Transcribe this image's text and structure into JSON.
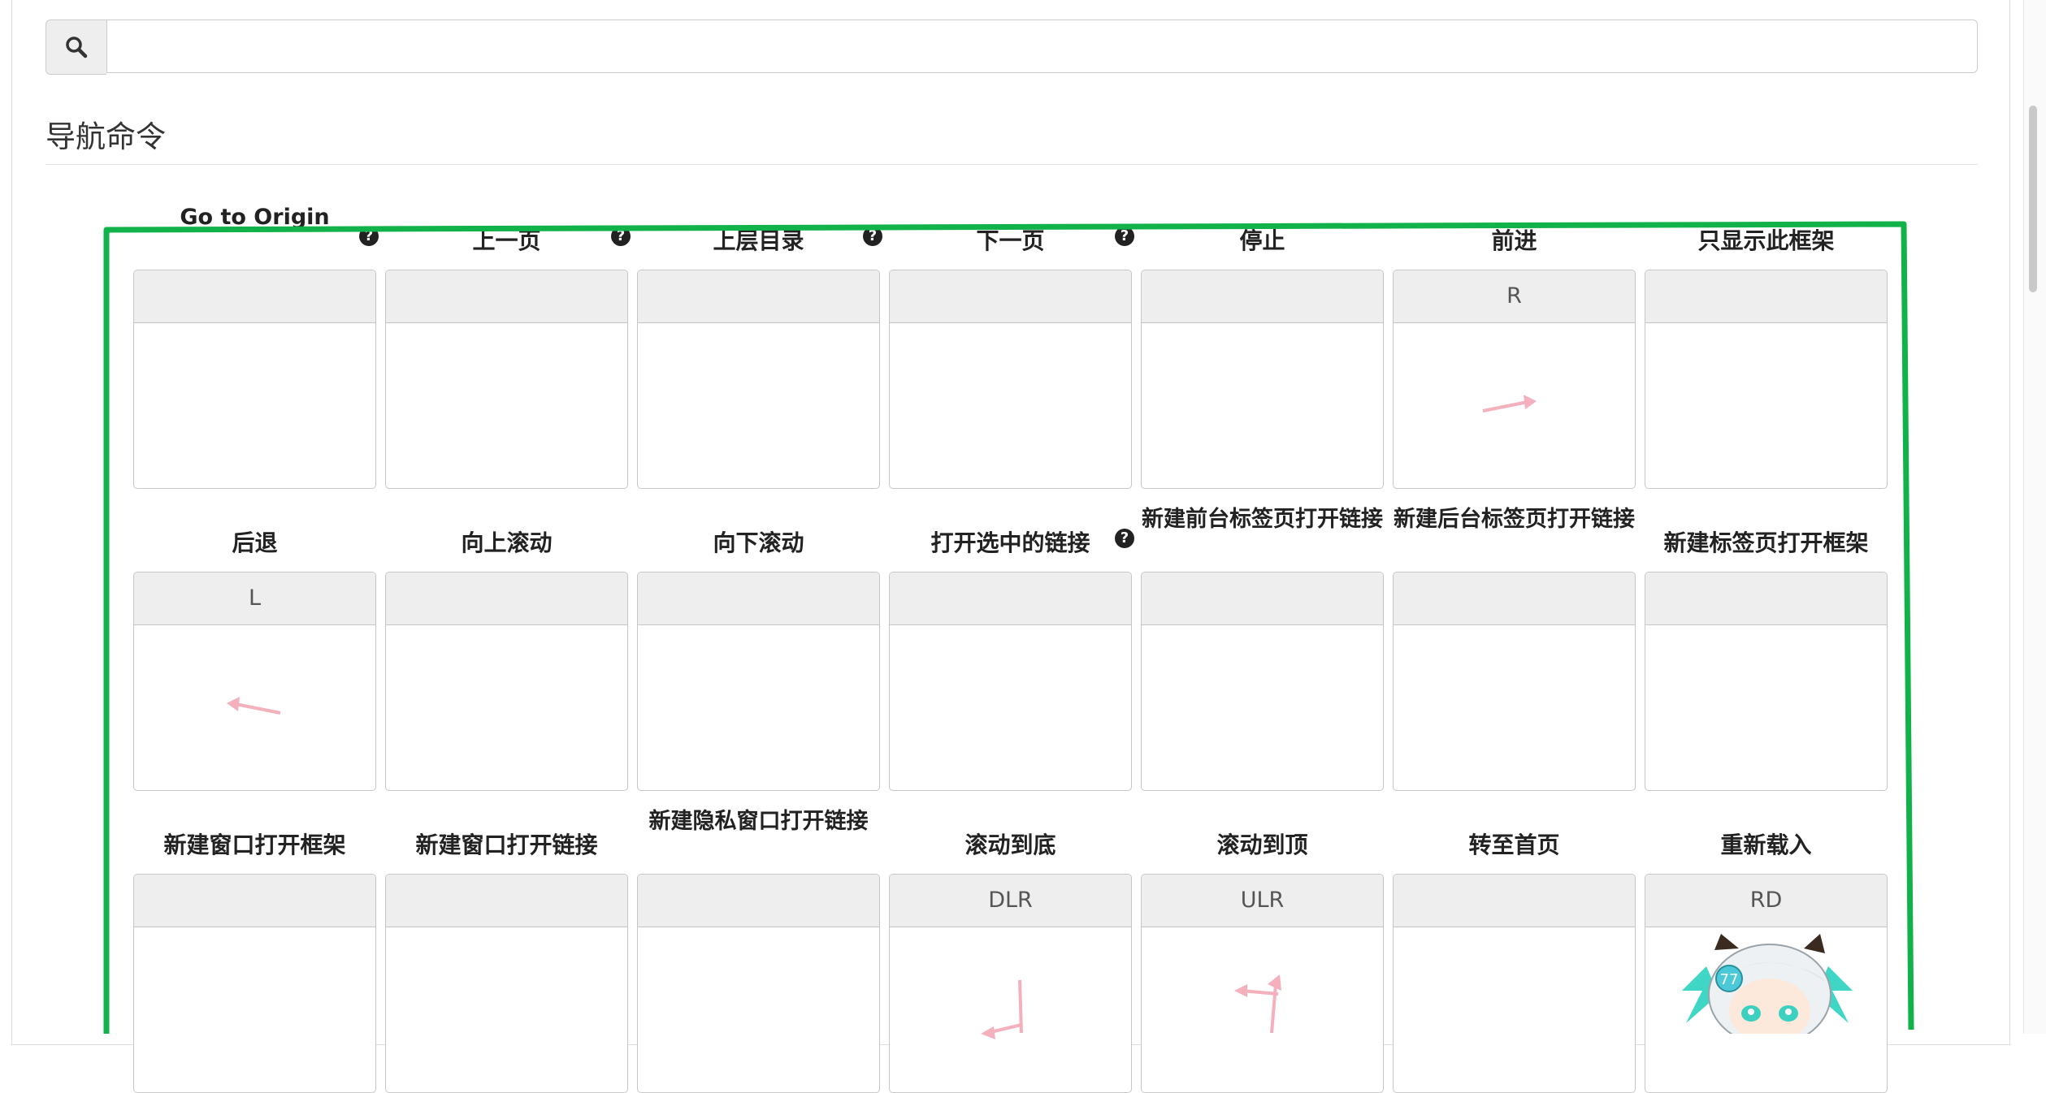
{
  "search": {
    "value": "",
    "placeholder": "",
    "icon": "search-icon"
  },
  "section": {
    "title": "导航命令"
  },
  "help_icon_glyph": "?",
  "colors": {
    "highlight": "#12b24a",
    "gesture": "#f4b0bd",
    "header_bg": "#eeeeee"
  },
  "commands": [
    {
      "label": "Go to Origin",
      "gesture": "",
      "help": true
    },
    {
      "label": "上一页",
      "gesture": "",
      "help": true
    },
    {
      "label": "上层目录",
      "gesture": "",
      "help": true
    },
    {
      "label": "下一页",
      "gesture": "",
      "help": true
    },
    {
      "label": "停止",
      "gesture": "",
      "help": false
    },
    {
      "label": "前进",
      "gesture": "R",
      "help": false
    },
    {
      "label": "只显示此框架",
      "gesture": "",
      "help": false
    },
    {
      "label": "后退",
      "gesture": "L",
      "help": false
    },
    {
      "label": "向上滚动",
      "gesture": "",
      "help": false
    },
    {
      "label": "向下滚动",
      "gesture": "",
      "help": false
    },
    {
      "label": "打开选中的链接",
      "gesture": "",
      "help": true
    },
    {
      "label": "新建前台标签页打开链接",
      "gesture": "",
      "help": false
    },
    {
      "label": "新建后台标签页打开链接",
      "gesture": "",
      "help": false
    },
    {
      "label": "新建标签页打开框架",
      "gesture": "",
      "help": false
    },
    {
      "label": "新建窗口打开框架",
      "gesture": "",
      "help": false
    },
    {
      "label": "新建窗口打开链接",
      "gesture": "",
      "help": false
    },
    {
      "label": "新建隐私窗口打开链接",
      "gesture": "",
      "help": false
    },
    {
      "label": "滚动到底",
      "gesture": "DLR",
      "help": false
    },
    {
      "label": "滚动到顶",
      "gesture": "ULR",
      "help": false
    },
    {
      "label": "转至首页",
      "gesture": "",
      "help": false
    },
    {
      "label": "重新载入",
      "gesture": "RD",
      "help": false
    }
  ]
}
